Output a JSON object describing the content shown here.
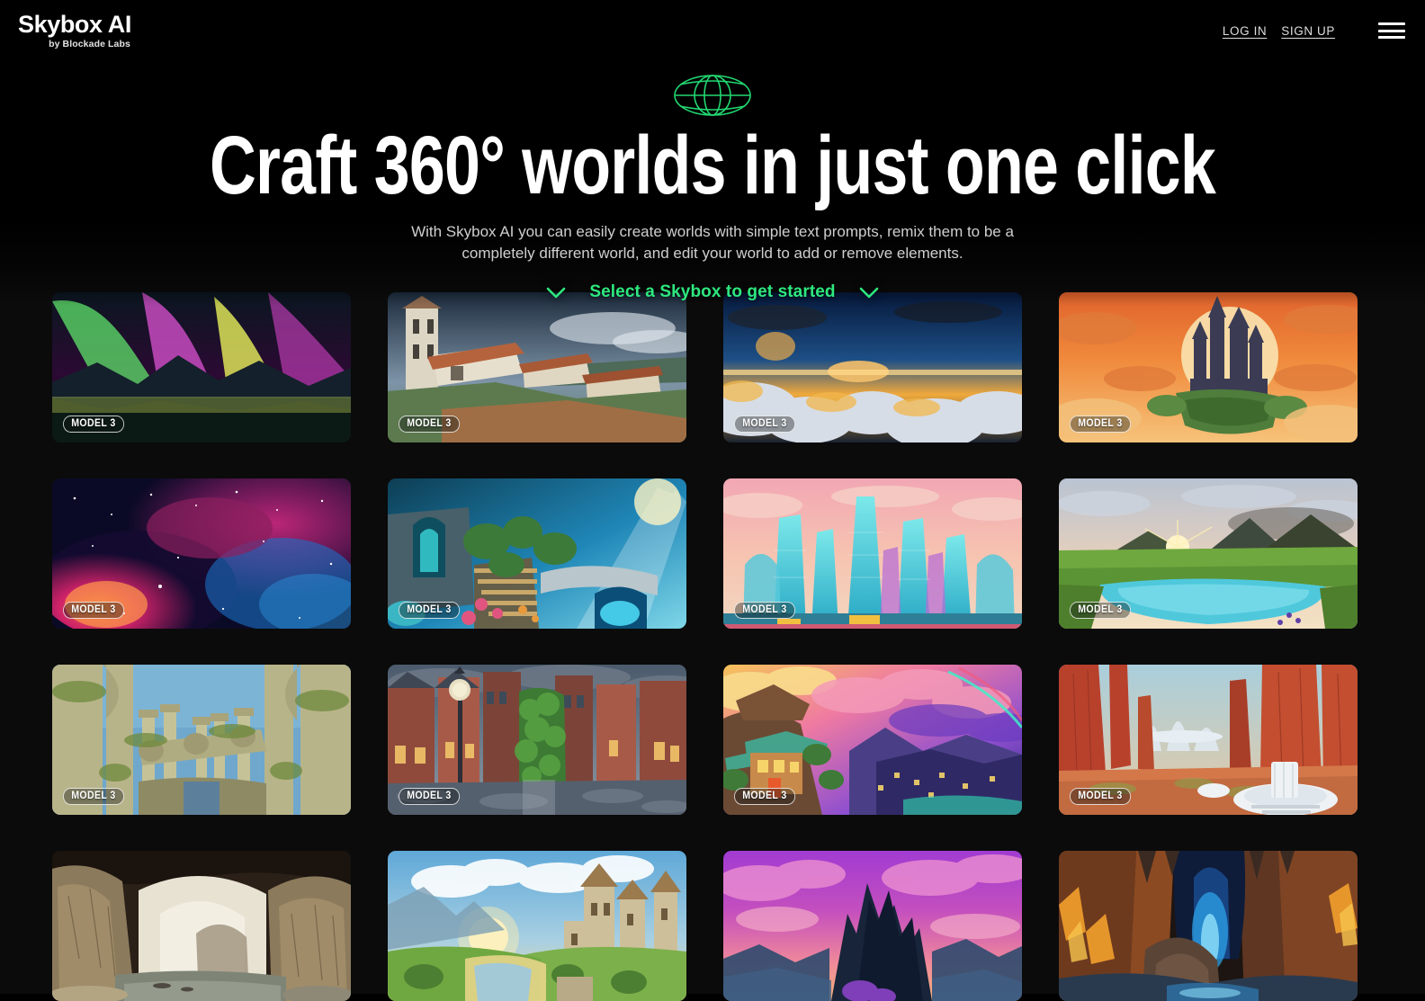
{
  "header": {
    "logo_main": "Skybox AI",
    "logo_sub": "by Blockade Labs",
    "login_label": "LOG IN",
    "signup_label": "SIGN UP",
    "menu_icon": "hamburger-menu-icon"
  },
  "hero": {
    "globe_icon": "globe-wireframe-icon",
    "title": "Craft 360° worlds in just one click",
    "subtitle": "With Skybox AI you can easily create worlds with simple text prompts, remix them to be a completely different world, and edit your world to add or remove elements.",
    "cta_label": "Select a Skybox to get started",
    "chevron_left_icon": "chevron-down-icon",
    "chevron_right_icon": "chevron-down-icon"
  },
  "colors": {
    "accent_green": "#2ee87f",
    "background": "#000000",
    "page_background": "#0b0b0b",
    "text_primary": "#ffffff",
    "text_secondary": "#cfcfcf"
  },
  "gallery": {
    "badge_label": "MODEL 3",
    "cards": [
      {
        "name": "aurora-borealis-lake",
        "badge": "MODEL 3",
        "alt": "Aurora borealis over mountains and lake"
      },
      {
        "name": "mediterranean-hill-village",
        "badge": "MODEL 3",
        "alt": "Mediterranean hillside village with tiled roofs"
      },
      {
        "name": "sunset-above-clouds",
        "badge": "MODEL 3",
        "alt": "Sunset horizon above a sea of clouds"
      },
      {
        "name": "fantasy-castle-sunset",
        "badge": "MODEL 3",
        "alt": "Fantasy castle on a cliff against orange sunset"
      },
      {
        "name": "cosmic-nebula",
        "badge": "MODEL 3",
        "alt": "Colorful cosmic nebula with stars"
      },
      {
        "name": "underwater-garden-ruins",
        "badge": "MODEL 3",
        "alt": "Luminous underwater garden with stone arches"
      },
      {
        "name": "futuristic-glass-city",
        "badge": "MODEL 3",
        "alt": "Futuristic glass skyscraper city at dusk"
      },
      {
        "name": "green-plains-lagoon",
        "badge": "MODEL 3",
        "alt": "Green plains with lagoon and sunrise over hills"
      },
      {
        "name": "ancient-stone-ruins",
        "badge": "MODEL 3",
        "alt": "Ancient mossy stone columns and ruins"
      },
      {
        "name": "rainy-cobblestone-street",
        "badge": "MODEL 3",
        "alt": "Rainy cobblestone street with clock tower and ivy"
      },
      {
        "name": "anime-cliffside-village",
        "badge": "MODEL 3",
        "alt": "Anime style cliffside village at vivid sunset"
      },
      {
        "name": "red-canyon-sci-fi-base",
        "badge": "MODEL 3",
        "alt": "Red rock canyon with white sci-fi structures"
      },
      {
        "name": "sea-cave-arch",
        "badge": "",
        "alt": "Sea cave rock arch opening to misty water"
      },
      {
        "name": "castle-valley-sunrise",
        "badge": "",
        "alt": "Castle above green valley at golden sunrise"
      },
      {
        "name": "purple-sky-dark-peaks",
        "badge": "",
        "alt": "Dark jagged peaks against magenta clouded sky"
      },
      {
        "name": "crystal-lava-cavern",
        "badge": "",
        "alt": "Cavern with glowing lava and blue crystal light"
      }
    ]
  }
}
